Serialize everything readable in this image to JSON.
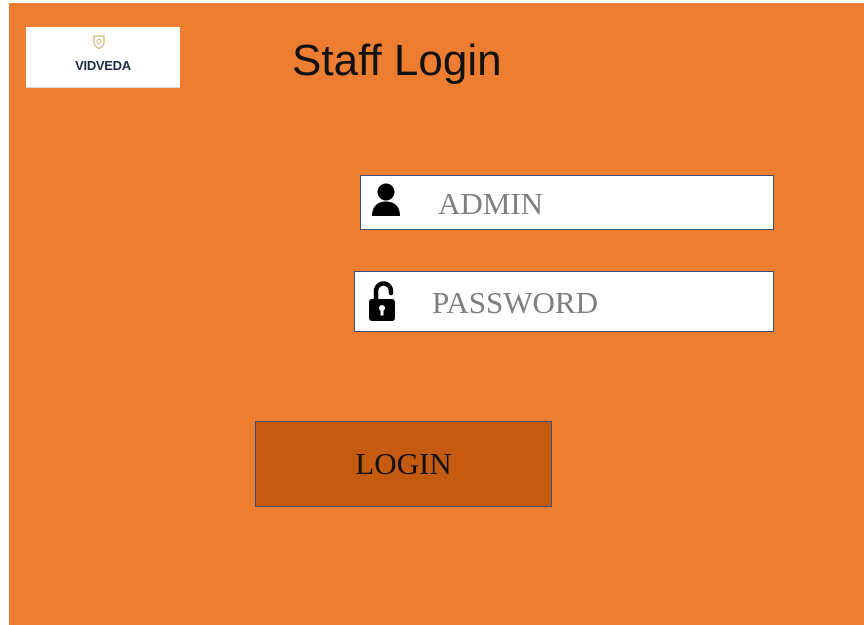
{
  "page": {
    "title": "Staff Login",
    "background_color": "#ED7D31"
  },
  "logo": {
    "text": "VIDVEDA",
    "emblem_icon": "shield-crest-icon"
  },
  "username": {
    "placeholder": "ADMIN",
    "icon": "user-icon"
  },
  "password": {
    "placeholder": "PASSWORD",
    "icon": "unlock-icon"
  },
  "login_button": {
    "label": "LOGIN",
    "color": "#C55A11"
  }
}
